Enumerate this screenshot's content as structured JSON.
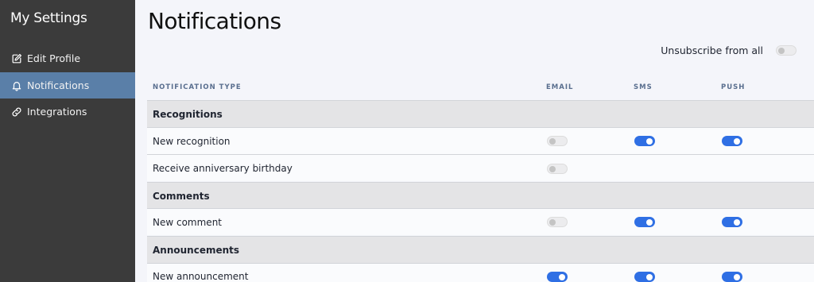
{
  "sidebar": {
    "title": "My Settings",
    "items": [
      {
        "label": "Edit Profile",
        "icon": "edit-icon",
        "active": false
      },
      {
        "label": "Notifications",
        "icon": "bell-icon",
        "active": true
      },
      {
        "label": "Integrations",
        "icon": "link-icon",
        "active": false
      }
    ]
  },
  "main": {
    "title": "Notifications",
    "unsubscribe": {
      "label": "Unsubscribe from all",
      "enabled": false
    },
    "columns": {
      "type": "NOTIFICATION TYPE",
      "email": "EMAIL",
      "sms": "SMS",
      "push": "PUSH"
    },
    "rows": [
      {
        "kind": "section",
        "label": "Recognitions"
      },
      {
        "kind": "item",
        "label": "New recognition",
        "email": false,
        "sms": true,
        "push": true
      },
      {
        "kind": "item",
        "label": "Receive anniversary birthday",
        "email": false,
        "sms": null,
        "push": null
      },
      {
        "kind": "section",
        "label": "Comments"
      },
      {
        "kind": "item",
        "label": "New comment",
        "email": false,
        "sms": true,
        "push": true
      },
      {
        "kind": "section",
        "label": "Announcements"
      },
      {
        "kind": "item",
        "label": "New announcement",
        "email": true,
        "sms": true,
        "push": true
      }
    ]
  },
  "colors": {
    "accent": "#2f6fe4",
    "sidebar_bg": "#3b3b3b",
    "sidebar_active": "#5a7fa8",
    "section_bg": "#e4e4e6"
  }
}
